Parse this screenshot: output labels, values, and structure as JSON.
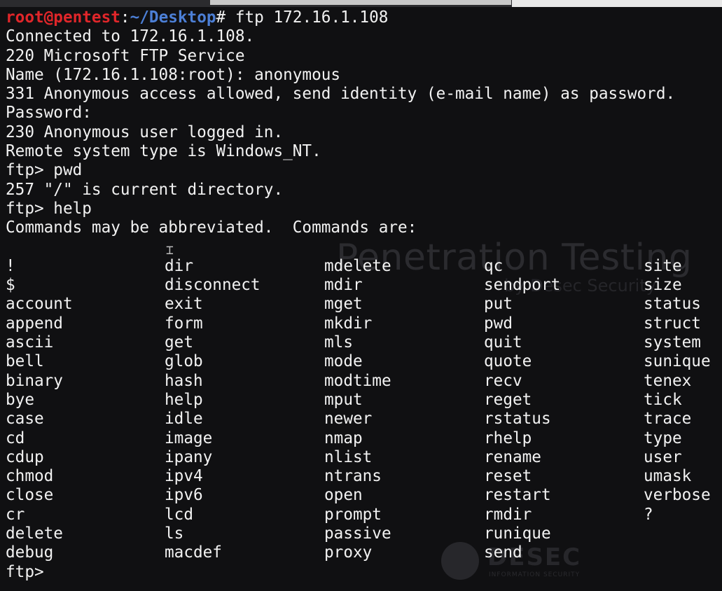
{
  "watermark": {
    "title": "Penetration Testing",
    "subtitle": "by Desec Security",
    "logo_text": "DESEC",
    "logo_subtext": "INFORMATION SECURITY"
  },
  "terminal": {
    "prompt_user": "root@pentest",
    "prompt_sep": ":",
    "prompt_path": "~/Desktop",
    "prompt_hash": "# ",
    "command": "ftp 172.16.1.108",
    "output_lines": [
      "Connected to 172.16.1.108.",
      "220 Microsoft FTP Service",
      "Name (172.16.1.108:root): anonymous",
      "331 Anonymous access allowed, send identity (e-mail name) as password.",
      "Password:",
      "230 Anonymous user logged in.",
      "Remote system type is Windows_NT.",
      "ftp> pwd",
      "257 \"/\" is current directory.",
      "ftp> help",
      "Commands may be abbreviated.  Commands are:"
    ],
    "commands_grid": [
      [
        "!",
        "dir",
        "mdelete",
        "qc",
        "site"
      ],
      [
        "$",
        "disconnect",
        "mdir",
        "sendport",
        "size"
      ],
      [
        "account",
        "exit",
        "mget",
        "put",
        "status"
      ],
      [
        "append",
        "form",
        "mkdir",
        "pwd",
        "struct"
      ],
      [
        "ascii",
        "get",
        "mls",
        "quit",
        "system"
      ],
      [
        "bell",
        "glob",
        "mode",
        "quote",
        "sunique"
      ],
      [
        "binary",
        "hash",
        "modtime",
        "recv",
        "tenex"
      ],
      [
        "bye",
        "help",
        "mput",
        "reget",
        "tick"
      ],
      [
        "case",
        "idle",
        "newer",
        "rstatus",
        "trace"
      ],
      [
        "cd",
        "image",
        "nmap",
        "rhelp",
        "type"
      ],
      [
        "cdup",
        "ipany",
        "nlist",
        "rename",
        "user"
      ],
      [
        "chmod",
        "ipv4",
        "ntrans",
        "reset",
        "umask"
      ],
      [
        "close",
        "ipv6",
        "open",
        "restart",
        "verbose"
      ],
      [
        "cr",
        "lcd",
        "prompt",
        "rmdir",
        "?"
      ],
      [
        "delete",
        "ls",
        "passive",
        "runique",
        ""
      ],
      [
        "debug",
        "macdef",
        "proxy",
        "send",
        ""
      ]
    ],
    "final_prompt": "ftp> "
  }
}
